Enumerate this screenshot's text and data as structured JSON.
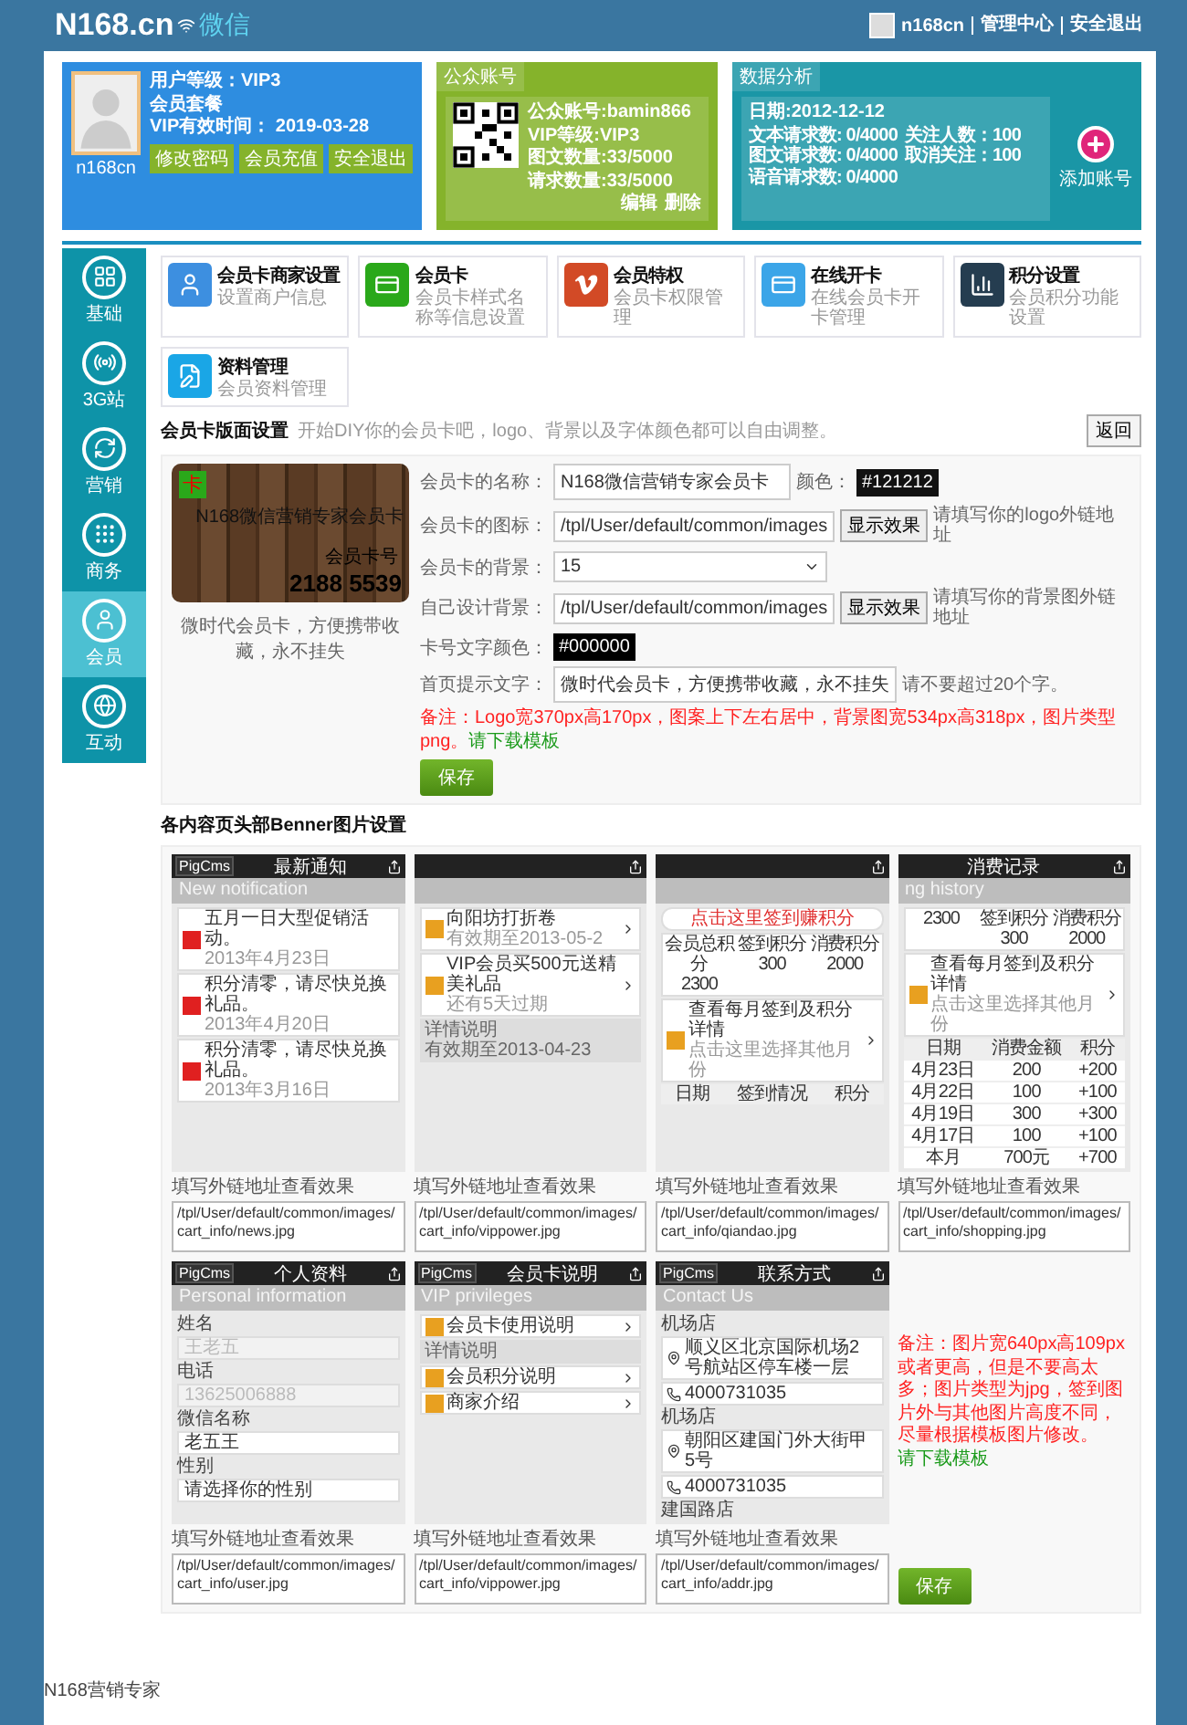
{
  "header": {
    "logo": "N168.cn",
    "logo_suffix": "微信",
    "user": "n168cn",
    "links": [
      "管理中心",
      "安全退出"
    ]
  },
  "profile": {
    "name": "n168cn",
    "lines": [
      "用户等级：VIP3",
      "会员套餐",
      "VIP有效时间： 2019-03-28"
    ],
    "buttons": [
      "修改密码",
      "会员充值",
      "安全退出"
    ]
  },
  "account": {
    "title": "公众账号",
    "lines": [
      "公众账号:bamin866",
      "VIP等级:VIP3",
      "图文数量:33/5000",
      "请求数量:33/5000"
    ],
    "actions": [
      "编辑",
      "删除"
    ]
  },
  "stats": {
    "title": "数据分析",
    "date": "日期:2012-12-12",
    "items": [
      "文本请求数: 0/4000",
      "关注人数：100",
      "图文请求数: 0/4000",
      "取消关注：100",
      "语音请求数: 0/4000"
    ],
    "add_label": "添加账号"
  },
  "sidebar": [
    {
      "label": "基础",
      "selected": false
    },
    {
      "label": "3G站",
      "selected": false
    },
    {
      "label": "营销",
      "selected": false
    },
    {
      "label": "商务",
      "selected": false
    },
    {
      "label": "会员",
      "selected": true
    },
    {
      "label": "互动",
      "selected": false
    }
  ],
  "modules": [
    {
      "title": "会员卡商家设置",
      "desc": "设置商户信息",
      "color": "#3d8fe0"
    },
    {
      "title": "会员卡",
      "desc": "会员卡样式名称等信息设置",
      "color": "#2aa81a"
    },
    {
      "title": "会员特权",
      "desc": "会员卡权限管理",
      "color": "#d24a26"
    },
    {
      "title": "在线开卡",
      "desc": "在线会员卡开卡管理",
      "color": "#3ba5e8"
    },
    {
      "title": "积分设置",
      "desc": "会员积分功能设置",
      "color": "#253d50"
    },
    {
      "title": "资料管理",
      "desc": "会员资料管理",
      "color": "#1aa6e6"
    }
  ],
  "card_settings": {
    "title": "会员卡版面设置",
    "hint": "开始DIY你的会员卡吧，logo、背景以及字体颜色都可以自由调整。",
    "back": "返回",
    "preview": {
      "logo": "卡",
      "name": "N168微信营销专家会员卡",
      "number_label": "会员卡号",
      "number": "2188 5539",
      "caption": "微时代会员卡，方便携带收藏，永不挂失"
    },
    "fields": [
      {
        "kind": "text",
        "label": "会员卡的名称：",
        "value": "N168微信营销专家会员卡",
        "color_label": "颜色：",
        "color_value": "#121212"
      },
      {
        "kind": "text",
        "label": "会员卡的图标：",
        "value": "/tpl/User/default/common/images",
        "button": "显示效果",
        "hint": "请填写你的logo外链地址"
      },
      {
        "kind": "select",
        "label": "会员卡的背景：",
        "value": "15"
      },
      {
        "kind": "text",
        "label": "自己设计背景：",
        "value": "/tpl/User/default/common/images",
        "button": "显示效果",
        "hint": "请填写你的背景图外链地址"
      },
      {
        "kind": "color",
        "label": "卡号文字颜色：",
        "color_value": "#000000"
      },
      {
        "kind": "text",
        "label": "首页提示文字：",
        "value": "微时代会员卡，方便携带收藏，永不挂失",
        "hint": "请不要超过20个字。"
      }
    ],
    "note": "备注：Logo宽370px高170px，图案上下左右居中，背景图宽534px高318px，图片类型png。",
    "note_link": "请下载模板",
    "save": "保存"
  },
  "banner_settings": {
    "title": "各内容页头部Benner图片设置",
    "previews": [
      {
        "brand": "PigCms",
        "title": "最新通知",
        "subtitle": "New notification",
        "label": "填写外链地址查看效果",
        "path": "/tpl/User/default/common/images/cart_info/news.jpg",
        "rows": [
          {
            "kind": "notice",
            "title": "五月一日大型促销活动。",
            "sub": "2013年4月23日"
          },
          {
            "kind": "notice",
            "title": "积分清零，请尽快兑换礼品。",
            "sub": "2013年4月20日"
          },
          {
            "kind": "notice",
            "title": "积分清零，请尽快兑换礼品。",
            "sub": "2013年3月16日"
          }
        ]
      },
      {
        "label": "填写外链地址查看效果",
        "path": "/tpl/User/default/common/images/cart_info/vippower.jpg",
        "rows": [
          {
            "kind": "item",
            "title": "向阳坊打折卷",
            "sub": "有效期至2013-05-2"
          },
          {
            "kind": "item",
            "title": "VIP会员买500元送精美礼品",
            "sub": "还有5天过期"
          },
          {
            "kind": "detail",
            "title": "详情说明",
            "bullets": [
              "有效期至2013-04-23"
            ]
          }
        ]
      },
      {
        "label": "填写外链地址查看效果",
        "path": "/tpl/User/default/common/images/cart_info/qiandao.jpg",
        "rows": [
          {
            "kind": "link",
            "title": "点击这里签到赚积分"
          },
          {
            "kind": "stats",
            "cells": [
              {
                "label": "会员总积分",
                "value": "2300"
              },
              {
                "label": "签到积分",
                "value": "300"
              },
              {
                "label": "消费积分",
                "value": "2000"
              }
            ]
          },
          {
            "kind": "item",
            "title": "查看每月签到及积分详情",
            "sub": "点击这里选择其他月份"
          },
          {
            "kind": "table",
            "header": [
              "日期",
              "签到情况",
              "积分"
            ],
            "rows": []
          }
        ]
      },
      {
        "title": "消费记录",
        "subtitle": "ng history",
        "label": "填写外链地址查看效果",
        "path": "/tpl/User/default/common/images/cart_info/shopping.jpg",
        "rows": [
          {
            "kind": "stats",
            "cells": [
              {
                "value": "2300"
              },
              {
                "label": "签到积分",
                "value": "300"
              },
              {
                "label": "消费积分",
                "value": "2000"
              }
            ]
          },
          {
            "kind": "item",
            "title": "查看每月签到及积分详情",
            "sub": "点击这里选择其他月份"
          },
          {
            "kind": "table",
            "header": [
              "日期",
              "消费金额",
              "积分"
            ],
            "rows": [
              [
                "4月23日",
                "200",
                "+200"
              ],
              [
                "4月22日",
                "100",
                "+100"
              ],
              [
                "4月19日",
                "300",
                "+300"
              ],
              [
                "4月17日",
                "100",
                "+100"
              ],
              [
                "本月",
                "700元",
                "+700"
              ]
            ]
          }
        ]
      },
      {
        "brand": "PigCms",
        "title": "个人资料",
        "subtitle": "Personal information",
        "label": "填写外链地址查看效果",
        "path": "/tpl/User/default/common/images/cart_info/user.jpg",
        "rows": [
          {
            "kind": "field",
            "title": "姓名",
            "placeholder": "王老五"
          },
          {
            "kind": "field",
            "title": "电话",
            "placeholder": "13625006888"
          },
          {
            "kind": "field",
            "title": "微信名称",
            "value": "老五王"
          },
          {
            "kind": "field",
            "title": "性别",
            "value": "请选择你的性别"
          }
        ]
      },
      {
        "brand": "PigCms",
        "title": "会员卡说明",
        "subtitle": "VIP privileges",
        "label": "填写外链地址查看效果",
        "path": "/tpl/User/default/common/images/cart_info/vippower.jpg",
        "rows": [
          {
            "kind": "item",
            "title": "会员卡使用说明"
          },
          {
            "kind": "detail",
            "title": "详情说明"
          },
          {
            "kind": "item",
            "title": "会员积分说明"
          },
          {
            "kind": "item",
            "title": "商家介绍"
          }
        ]
      },
      {
        "brand": "PigCms",
        "title": "联系方式",
        "subtitle": "Contact Us",
        "label": "填写外链地址查看效果",
        "path": "/tpl/User/default/common/images/cart_info/addr.jpg",
        "rows": [
          {
            "kind": "heading",
            "title": "机场店"
          },
          {
            "kind": "contact",
            "title": "顺义区北京国际机场2号航站区停车楼一层"
          },
          {
            "kind": "phone",
            "title": "4000731035"
          },
          {
            "kind": "heading",
            "title": "机场店"
          },
          {
            "kind": "contact",
            "title": "朝阳区建国门外大街甲5号"
          },
          {
            "kind": "phone",
            "title": "4000731035"
          },
          {
            "kind": "heading",
            "title": "建国路店"
          }
        ]
      }
    ],
    "note": "备注：图片宽640px高109px或者更高，但是不要高太多；图片类型为jpg，签到图片外与其他图片高度不同，尽量根据模板图片修改。",
    "note_link": "请下载模板",
    "save": "保存"
  },
  "footer": "N168营销专家"
}
